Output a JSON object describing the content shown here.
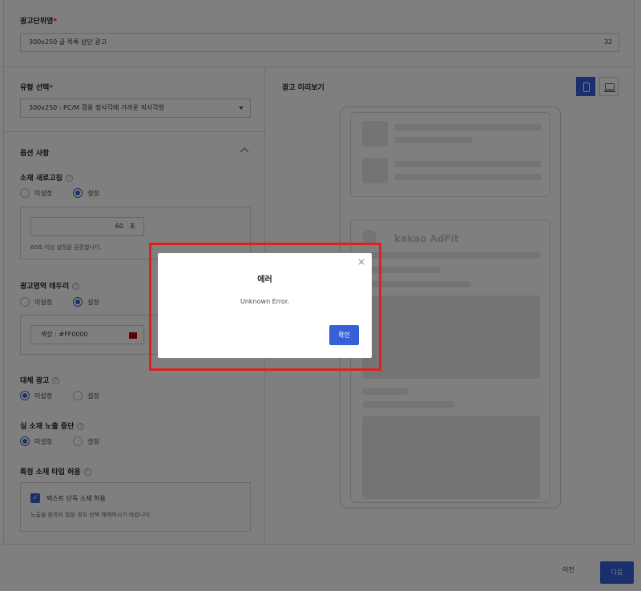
{
  "unit_name": {
    "label": "광고단위명",
    "required_mark": "*",
    "value": "300x250 글 목록 상단 광고",
    "char_count": "32"
  },
  "type_select": {
    "label": "유형 선택",
    "required_mark": "*",
    "value": "300x250 : PC/M 겸용 정사각에 가까운 직사각형"
  },
  "options": {
    "title": "옵션 사항",
    "refresh": {
      "label": "소재 새로고침",
      "off_label": "미설정",
      "on_label": "설정",
      "seconds_value": "60",
      "seconds_unit": "초",
      "note": "60초 이상 설정을 권장합니다."
    },
    "border": {
      "label": "광고영역 테두리",
      "off_label": "미설정",
      "on_label": "설정",
      "color_text": "색상 : #FF0000",
      "color_value": "#c00000"
    },
    "fallback": {
      "label": "대체 광고",
      "off_label": "미설정",
      "on_label": "설정"
    },
    "stop_real": {
      "label": "실 소재 노출 중단",
      "off_label": "미설정",
      "on_label": "설정"
    },
    "specific_type": {
      "label": "특정 소재 타입 허용",
      "checkbox_label": "텍스트 단독 소재 허용",
      "note": "노출을 원하지 않을 경우 선택 해제하시기 바랍니다."
    }
  },
  "preview": {
    "title": "광고 미리보기",
    "brand": "kakao AdFit"
  },
  "footer": {
    "prev_label": "이전",
    "next_label": "다음"
  },
  "modal": {
    "title": "에러",
    "message": "Unknown Error.",
    "confirm_label": "확인",
    "close_icon": "×"
  },
  "colors": {
    "accent": "#3560d8",
    "highlight": "#e0201e"
  }
}
